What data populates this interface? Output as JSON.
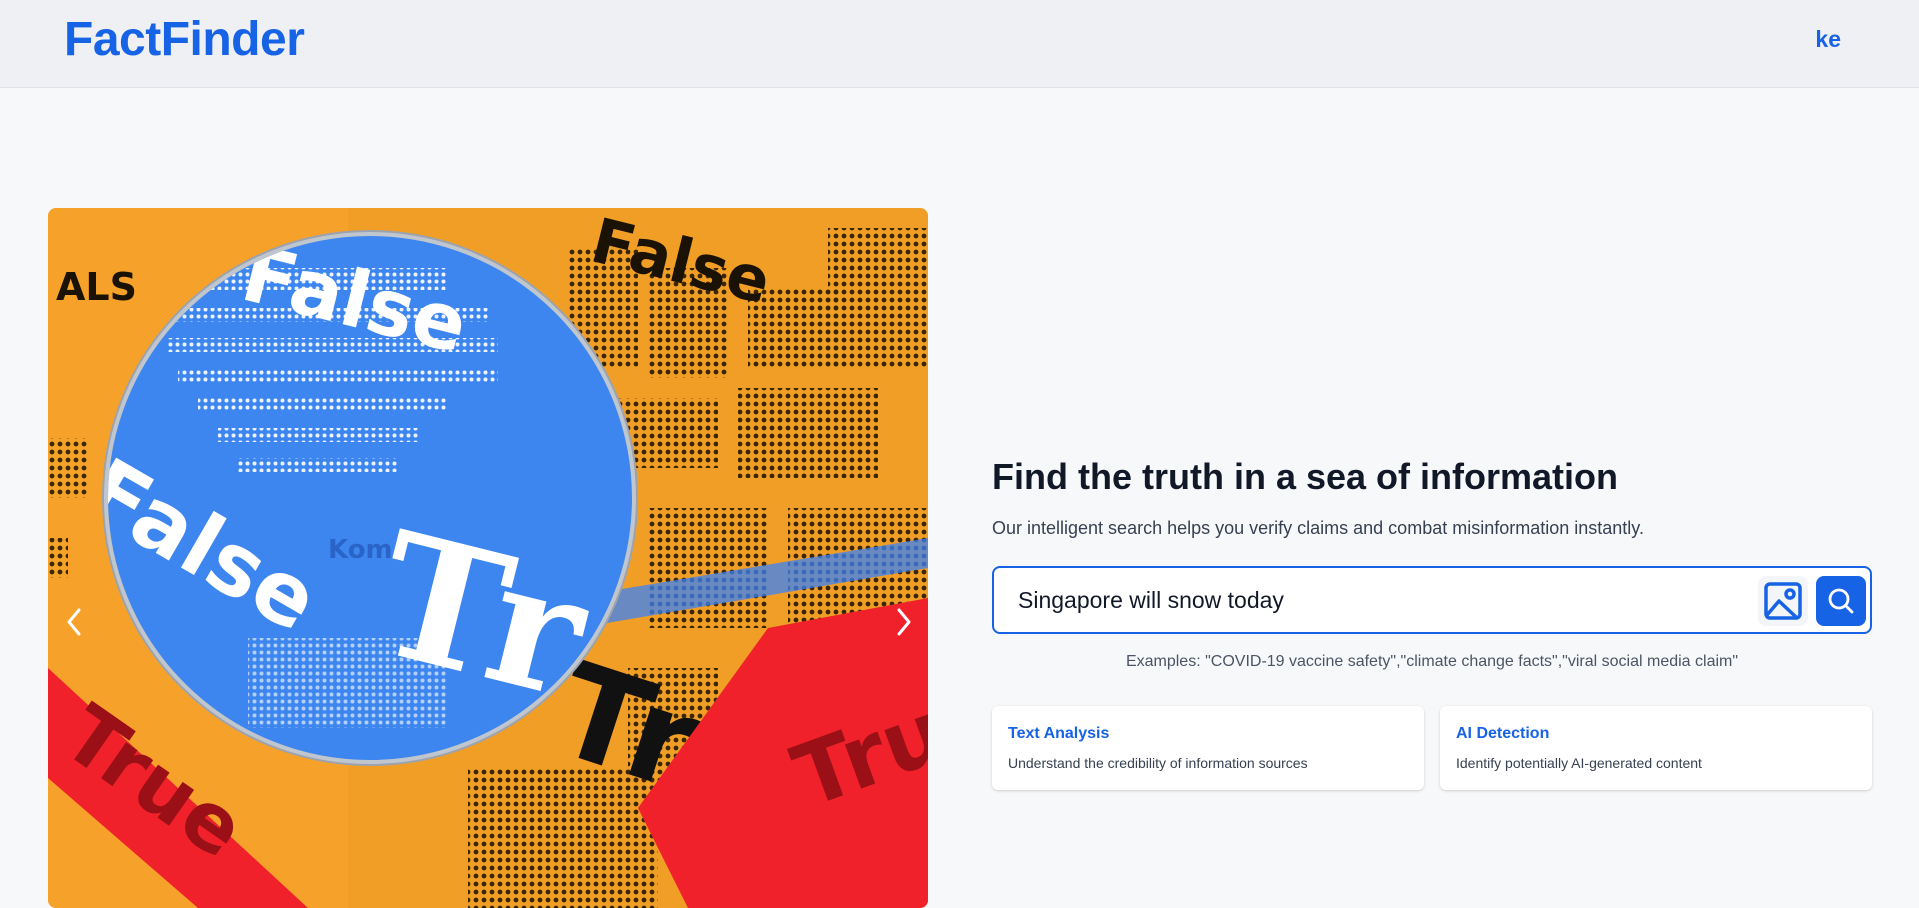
{
  "header": {
    "logo": "FactFinder",
    "user_initials": "ke"
  },
  "carousel": {
    "image_words": [
      "ALS",
      "False",
      "False",
      "True",
      "True",
      "True",
      "Kom"
    ]
  },
  "hero": {
    "title": "Find the truth in a sea of information",
    "subtitle": "Our intelligent search helps you verify claims and combat misinformation instantly."
  },
  "search": {
    "value": "Singapore will snow today",
    "examples": "Examples: \"COVID-19 vaccine safety\",\"climate change facts\",\"viral social media claim\""
  },
  "features": [
    {
      "title": "Text Analysis",
      "description": "Understand the credibility of information sources"
    },
    {
      "title": "AI Detection",
      "description": "Identify potentially AI-generated content"
    }
  ],
  "colors": {
    "accent": "#1763e6",
    "header_bg": "#eef0f4",
    "page_bg": "#f7f8fa"
  },
  "icons": {
    "prev": "chevron-left-icon",
    "next": "chevron-right-icon",
    "image_upload": "image-icon",
    "search": "search-icon"
  }
}
